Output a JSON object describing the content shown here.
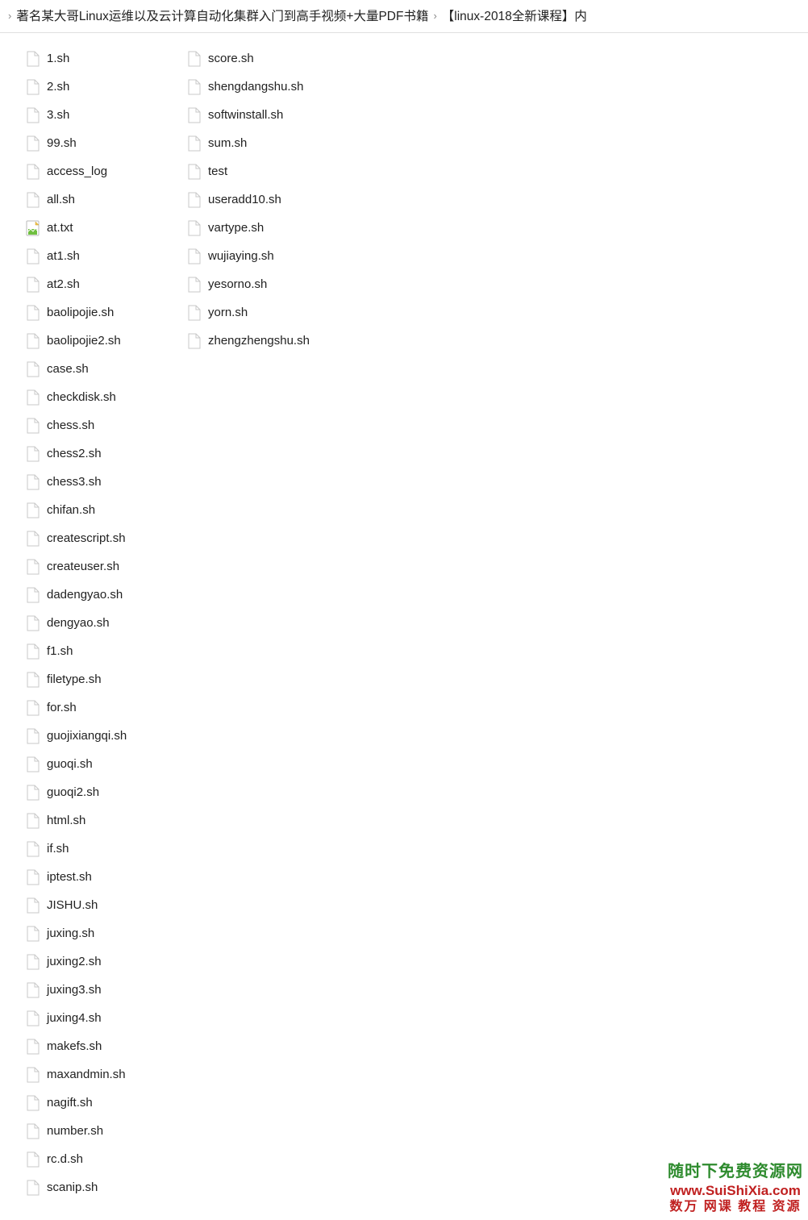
{
  "breadcrumb": {
    "items": [
      "著名某大哥Linux运维以及云计算自动化集群入门到高手视频+大量PDF书籍",
      "【linux-2018全新课程】内"
    ]
  },
  "files": [
    {
      "name": "1.sh",
      "icon": "blank"
    },
    {
      "name": "2.sh",
      "icon": "blank"
    },
    {
      "name": "3.sh",
      "icon": "blank"
    },
    {
      "name": "99.sh",
      "icon": "blank"
    },
    {
      "name": "access_log",
      "icon": "blank"
    },
    {
      "name": "all.sh",
      "icon": "blank"
    },
    {
      "name": "at.txt",
      "icon": "txt"
    },
    {
      "name": "at1.sh",
      "icon": "blank"
    },
    {
      "name": "at2.sh",
      "icon": "blank"
    },
    {
      "name": "baolipojie.sh",
      "icon": "blank"
    },
    {
      "name": "baolipojie2.sh",
      "icon": "blank"
    },
    {
      "name": "case.sh",
      "icon": "blank"
    },
    {
      "name": "checkdisk.sh",
      "icon": "blank"
    },
    {
      "name": "chess.sh",
      "icon": "blank"
    },
    {
      "name": "chess2.sh",
      "icon": "blank"
    },
    {
      "name": "chess3.sh",
      "icon": "blank"
    },
    {
      "name": "chifan.sh",
      "icon": "blank"
    },
    {
      "name": "createscript.sh",
      "icon": "blank"
    },
    {
      "name": "createuser.sh",
      "icon": "blank"
    },
    {
      "name": "dadengyao.sh",
      "icon": "blank"
    },
    {
      "name": "dengyao.sh",
      "icon": "blank"
    },
    {
      "name": "f1.sh",
      "icon": "blank"
    },
    {
      "name": "filetype.sh",
      "icon": "blank"
    },
    {
      "name": "for.sh",
      "icon": "blank"
    },
    {
      "name": "guojixiangqi.sh",
      "icon": "blank"
    },
    {
      "name": "guoqi.sh",
      "icon": "blank"
    },
    {
      "name": "guoqi2.sh",
      "icon": "blank"
    },
    {
      "name": "html.sh",
      "icon": "blank"
    },
    {
      "name": "if.sh",
      "icon": "blank"
    },
    {
      "name": "iptest.sh",
      "icon": "blank"
    },
    {
      "name": "JISHU.sh",
      "icon": "blank"
    },
    {
      "name": "juxing.sh",
      "icon": "blank"
    },
    {
      "name": "juxing2.sh",
      "icon": "blank"
    },
    {
      "name": "juxing3.sh",
      "icon": "blank"
    },
    {
      "name": "juxing4.sh",
      "icon": "blank"
    },
    {
      "name": "makefs.sh",
      "icon": "blank"
    },
    {
      "name": "maxandmin.sh",
      "icon": "blank"
    },
    {
      "name": "nagift.sh",
      "icon": "blank"
    },
    {
      "name": "number.sh",
      "icon": "blank"
    },
    {
      "name": "rc.d.sh",
      "icon": "blank"
    },
    {
      "name": "scanip.sh",
      "icon": "blank"
    },
    {
      "name": "score.sh",
      "icon": "blank"
    },
    {
      "name": "shengdangshu.sh",
      "icon": "blank"
    },
    {
      "name": "softwinstall.sh",
      "icon": "blank"
    },
    {
      "name": "sum.sh",
      "icon": "blank"
    },
    {
      "name": "test",
      "icon": "blank"
    },
    {
      "name": "useradd10.sh",
      "icon": "blank"
    },
    {
      "name": "vartype.sh",
      "icon": "blank"
    },
    {
      "name": "wujiaying.sh",
      "icon": "blank"
    },
    {
      "name": "yesorno.sh",
      "icon": "blank"
    },
    {
      "name": "yorn.sh",
      "icon": "blank"
    },
    {
      "name": "zhengzhengshu.sh",
      "icon": "blank"
    }
  ],
  "watermark": {
    "line1": "随时下免费资源网",
    "line2": "www.SuiShiXia.com",
    "line3": "数万 网课 教程 资源"
  }
}
